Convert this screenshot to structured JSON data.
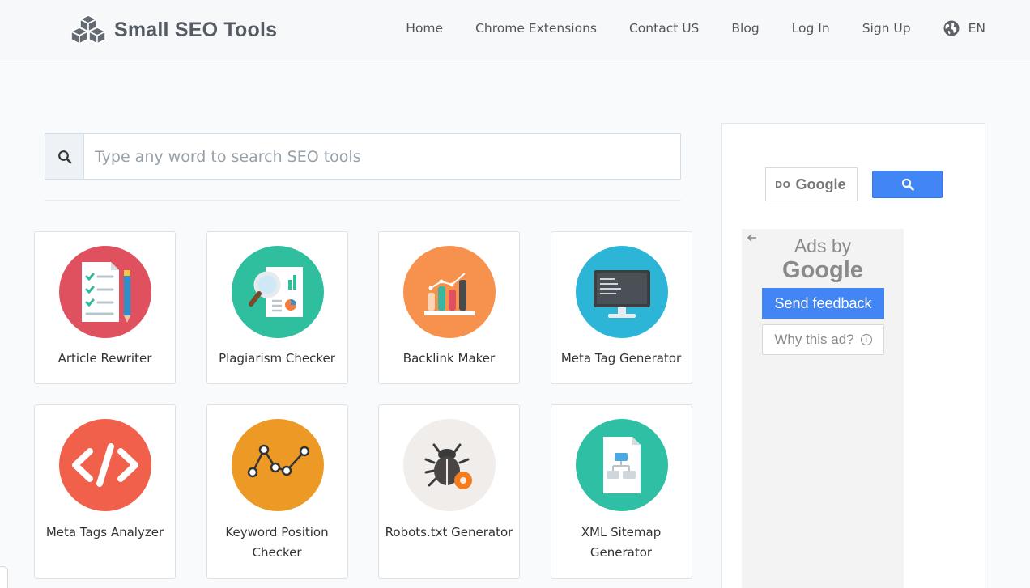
{
  "header": {
    "logo_text": "Small SEO Tools",
    "nav": [
      "Home",
      "Chrome Extensions",
      "Contact US",
      "Blog",
      "Log In",
      "Sign Up"
    ],
    "language": "EN"
  },
  "search": {
    "placeholder": "Type any word to search SEO tools",
    "value": ""
  },
  "tools": [
    {
      "label": "Article Rewriter",
      "icon": "article-rewriter-icon",
      "color": "#e0515f"
    },
    {
      "label": "Plagiarism Checker",
      "icon": "plagiarism-checker-icon",
      "color": "#2fbf9f"
    },
    {
      "label": "Backlink Maker",
      "icon": "backlink-maker-icon",
      "color": "#f7924e"
    },
    {
      "label": "Meta Tag Generator",
      "icon": "meta-tag-generator-icon",
      "color": "#2db5d8"
    },
    {
      "label": "Meta Tags Analyzer",
      "icon": "code-icon",
      "color": "#f0604b"
    },
    {
      "label": "Keyword Position Checker",
      "icon": "keyword-position-icon",
      "color": "#ec9a25"
    },
    {
      "label": "Robots.txt Generator",
      "icon": "robot-bug-icon",
      "color": "#f0edea"
    },
    {
      "label": "XML Sitemap Generator",
      "icon": "sitemap-icon",
      "color": "#2fbfa4"
    }
  ],
  "sidebar": {
    "gsearch_prefix": "DO",
    "gsearch_brand": "Google",
    "ads_by": "Ads by",
    "ads_brand": "Google",
    "send_feedback": "Send feedback",
    "why_this_ad": "Why this ad?",
    "info_glyph": "i"
  }
}
